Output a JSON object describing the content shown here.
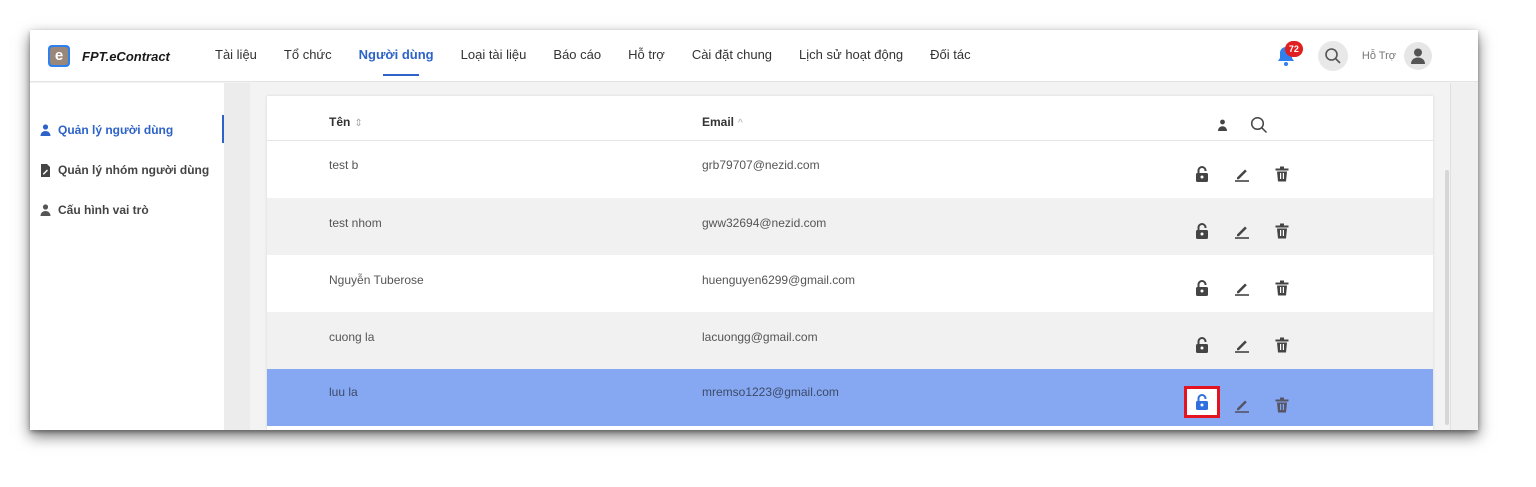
{
  "brand": {
    "name": "FPT.eContract",
    "logo_letter": "e"
  },
  "nav": {
    "items": [
      {
        "label": "Tài liệu"
      },
      {
        "label": "Tổ chức"
      },
      {
        "label": "Người dùng",
        "active": true
      },
      {
        "label": "Loại tài liệu"
      },
      {
        "label": "Báo cáo"
      },
      {
        "label": "Hỗ trợ"
      },
      {
        "label": "Cài đặt chung"
      },
      {
        "label": "Lịch sử hoạt động"
      },
      {
        "label": "Đối tác"
      }
    ],
    "notification_count": "72",
    "user_name": "Hỗ Trợ"
  },
  "sidebar": {
    "items": [
      {
        "label": "Quản lý người dùng",
        "icon": "person-icon",
        "active": true
      },
      {
        "label": "Quản lý nhóm người dùng",
        "icon": "document-edit-icon"
      },
      {
        "label": "Cấu hình vai trò",
        "icon": "person-icon"
      }
    ]
  },
  "table": {
    "columns": [
      {
        "label": "Tên",
        "sort": "⇕"
      },
      {
        "label": "Email",
        "sort": "^"
      }
    ],
    "rows": [
      {
        "name": "test b",
        "email": "grb79707@nezid.com"
      },
      {
        "name": "test nhom",
        "email": "gww32694@nezid.com"
      },
      {
        "name": "Nguyễn Tuberose",
        "email": "huenguyen6299@gmail.com"
      },
      {
        "name": "cuong la",
        "email": "lacuongg@gmail.com"
      },
      {
        "name": "luu la",
        "email": "mremso1223@gmail.com",
        "selected": true
      }
    ],
    "row_actions": [
      "unlock-icon",
      "edit-icon",
      "delete-icon"
    ]
  },
  "colors": {
    "accent": "#2d62c9",
    "selected_row": "#86a8f3",
    "highlight_border": "#e3141f",
    "badge": "#e02020"
  }
}
